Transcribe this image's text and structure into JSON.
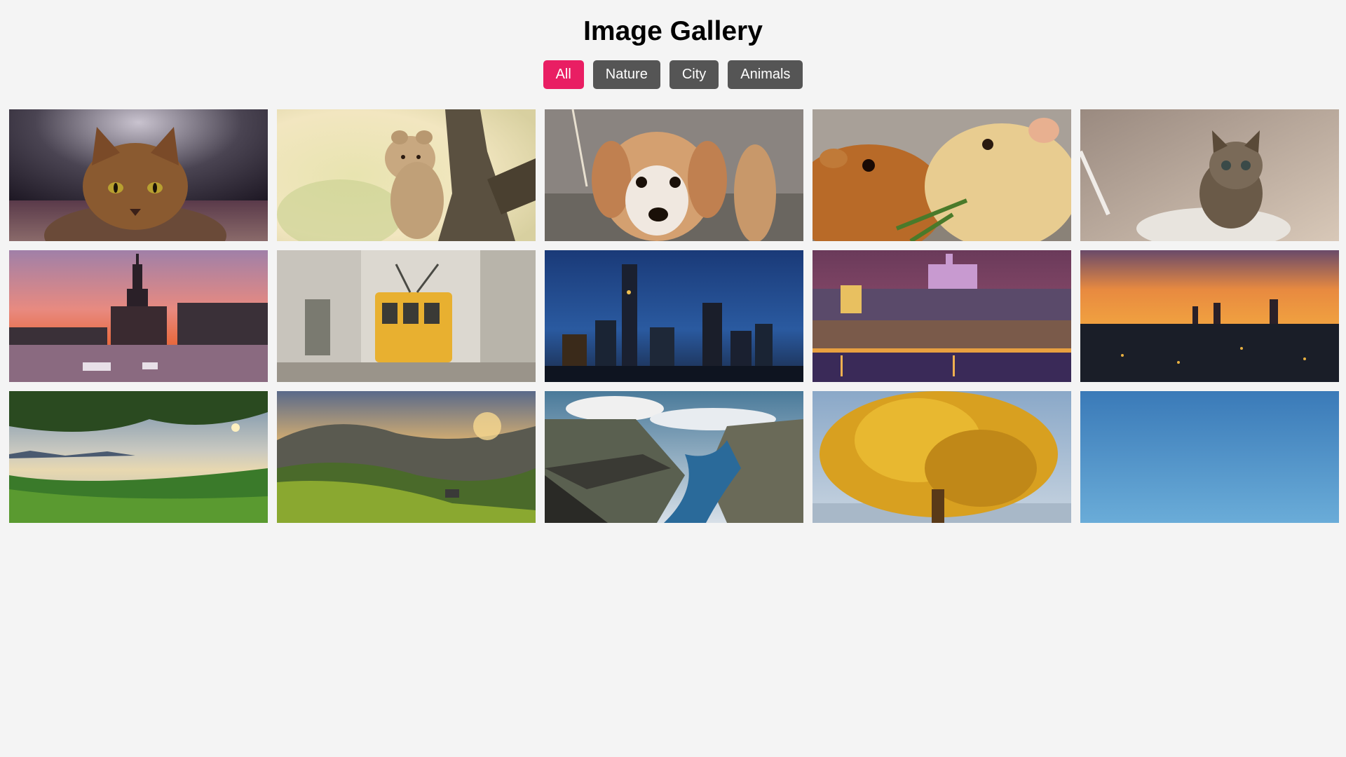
{
  "page": {
    "title": "Image Gallery"
  },
  "filters": [
    {
      "label": "All",
      "active": true
    },
    {
      "label": "Nature",
      "active": false
    },
    {
      "label": "City",
      "active": false
    },
    {
      "label": "Animals",
      "active": false
    }
  ],
  "colors": {
    "accent": "#e91e63",
    "button": "#555555",
    "background": "#f4f4f4"
  },
  "gallery": [
    {
      "subject": "tabby-cat",
      "category": "Animals"
    },
    {
      "subject": "lion-cub",
      "category": "Animals"
    },
    {
      "subject": "puppy",
      "category": "Animals"
    },
    {
      "subject": "guinea-pigs",
      "category": "Animals"
    },
    {
      "subject": "kitten",
      "category": "Animals"
    },
    {
      "subject": "river-city-sunset",
      "category": "City"
    },
    {
      "subject": "yellow-tram",
      "category": "City"
    },
    {
      "subject": "skyline-night",
      "category": "City"
    },
    {
      "subject": "castle-night",
      "category": "City"
    },
    {
      "subject": "city-sunset-panorama",
      "category": "City"
    },
    {
      "subject": "coast-tree",
      "category": "Nature"
    },
    {
      "subject": "rice-terraces",
      "category": "Nature"
    },
    {
      "subject": "fjord-cliff",
      "category": "Nature"
    },
    {
      "subject": "golden-tree",
      "category": "Nature"
    },
    {
      "subject": "blue-sky",
      "category": "Nature"
    }
  ]
}
